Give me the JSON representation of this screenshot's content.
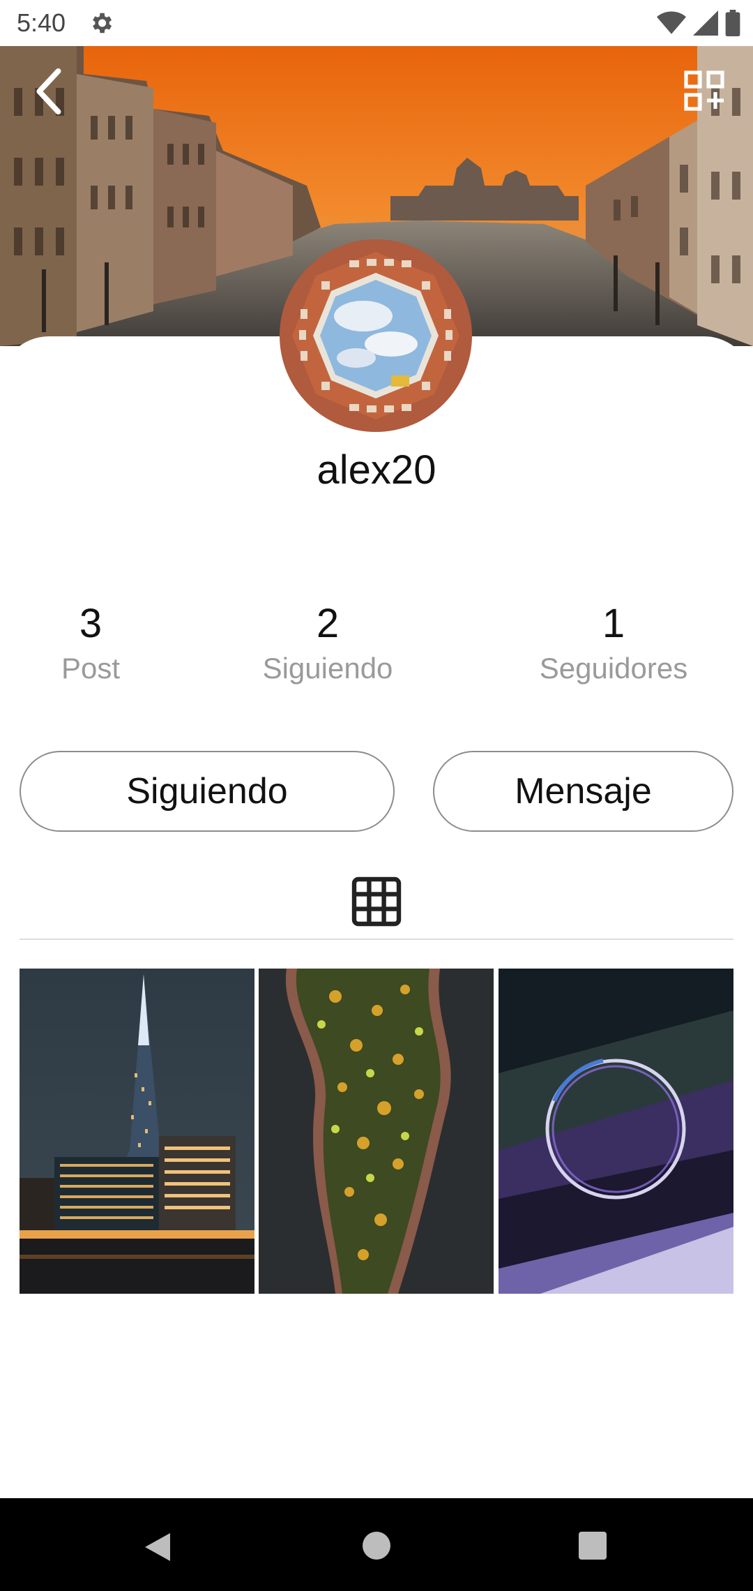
{
  "status_bar": {
    "time": "5:40",
    "icons": [
      "settings-gear-icon",
      "wifi-icon",
      "signal-icon",
      "battery-icon"
    ]
  },
  "header": {
    "back_icon": "chevron-left-icon",
    "qr_icon": "qr-add-icon"
  },
  "profile": {
    "username": "alex20"
  },
  "stats": [
    {
      "value": "3",
      "label": "Post"
    },
    {
      "value": "2",
      "label": "Siguiendo"
    },
    {
      "value": "1",
      "label": "Seguidores"
    }
  ],
  "actions": {
    "follow_label": "Siguiendo",
    "message_label": "Mensaje"
  },
  "tabs": {
    "grid_icon": "grid-icon"
  },
  "posts": [
    {
      "subject": "night-skyscraper"
    },
    {
      "subject": "aerial-forest-river"
    },
    {
      "subject": "abstract-neon-ring"
    }
  ],
  "nav_bar": {
    "icons": [
      "back-triangle-icon",
      "home-circle-icon",
      "recents-square-icon"
    ]
  },
  "colors": {
    "accent_text": "#111111",
    "muted_text": "#9a9a9a",
    "pill_border": "#8c8c8c",
    "nav_bg": "#000000"
  }
}
